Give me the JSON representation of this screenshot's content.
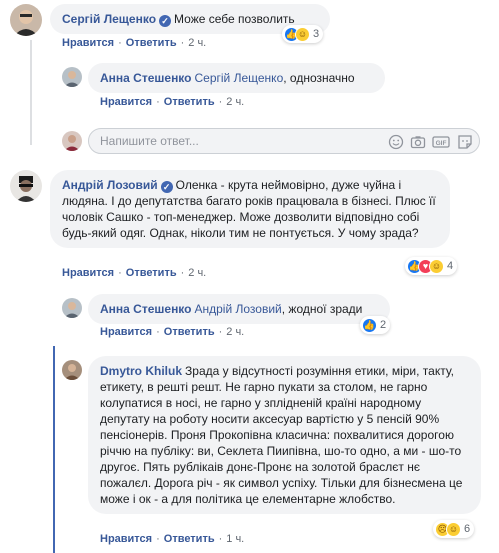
{
  "comments": [
    {
      "author": "Сергій Лещенко",
      "verified": true,
      "text": "Може себе позволить",
      "actions": {
        "like": "Нравится",
        "reply": "Ответить",
        "time": "2 ч."
      },
      "reactions": {
        "icons": [
          "like",
          "haha"
        ],
        "count": "3"
      }
    },
    {
      "author": "Анна Стешенко",
      "mention": "Сергій Лещенко",
      "text": ", однозначно",
      "actions": {
        "like": "Нравится",
        "reply": "Ответить",
        "time": "2 ч."
      }
    },
    {
      "author": "Андрій Лозовий",
      "verified": true,
      "text": "Оленка - крута неймовірно, дуже чуйна і людяна. І до депутатства багато років працювала в бізнесі. Плюс її чоловік Сашко - топ-менеджер. Може дозволити відповідно собі будь-який одяг. Однак, ніколи тим не понтується. У чому зрада?",
      "actions": {
        "like": "Нравится",
        "reply": "Ответить",
        "time": "2 ч."
      },
      "reactions": {
        "icons": [
          "like",
          "love",
          "haha"
        ],
        "count": "4"
      }
    },
    {
      "author": "Анна Стешенко",
      "mention": "Андрій Лозовий",
      "text": ", жодної зради",
      "actions": {
        "like": "Нравится",
        "reply": "Ответить",
        "time": "2 ч."
      },
      "reactions": {
        "icons": [
          "like"
        ],
        "count": "2"
      }
    },
    {
      "author": "Dmytro Khiluk",
      "text": "Зрада у відсутності розуміння етики, міри, такту, етикету, в решті решт. Не гарно пукати за столом, не гарно колупатися в носі, не гарно у зплідненій країні народному депутату на роботу носити аксесуар вартістю у 5 пенсій 90% пенсіонерів. Проня Прокопівна класична: похвалитися дорогою річчю на публіку: ви, Секлета Пиипівна, шо-то одно, а ми - шо-то другоє. Пять рублікаів донє-Пронє на золотой браслєт нє пожалєл. Дорога річ - як символ успіху. Тільки для бізнесмена це може і ок - а для політика це елементарне жлобство.",
      "actions": {
        "like": "Нравится",
        "reply": "Ответить",
        "time": "1 ч."
      },
      "reactions": {
        "icons": [
          "sad",
          "haha"
        ],
        "count": "6"
      }
    }
  ],
  "reply_box": {
    "placeholder": "Напишите ответ..."
  },
  "icons": [
    "emoji-icon",
    "camera-icon",
    "gif-icon",
    "sticker-icon"
  ]
}
